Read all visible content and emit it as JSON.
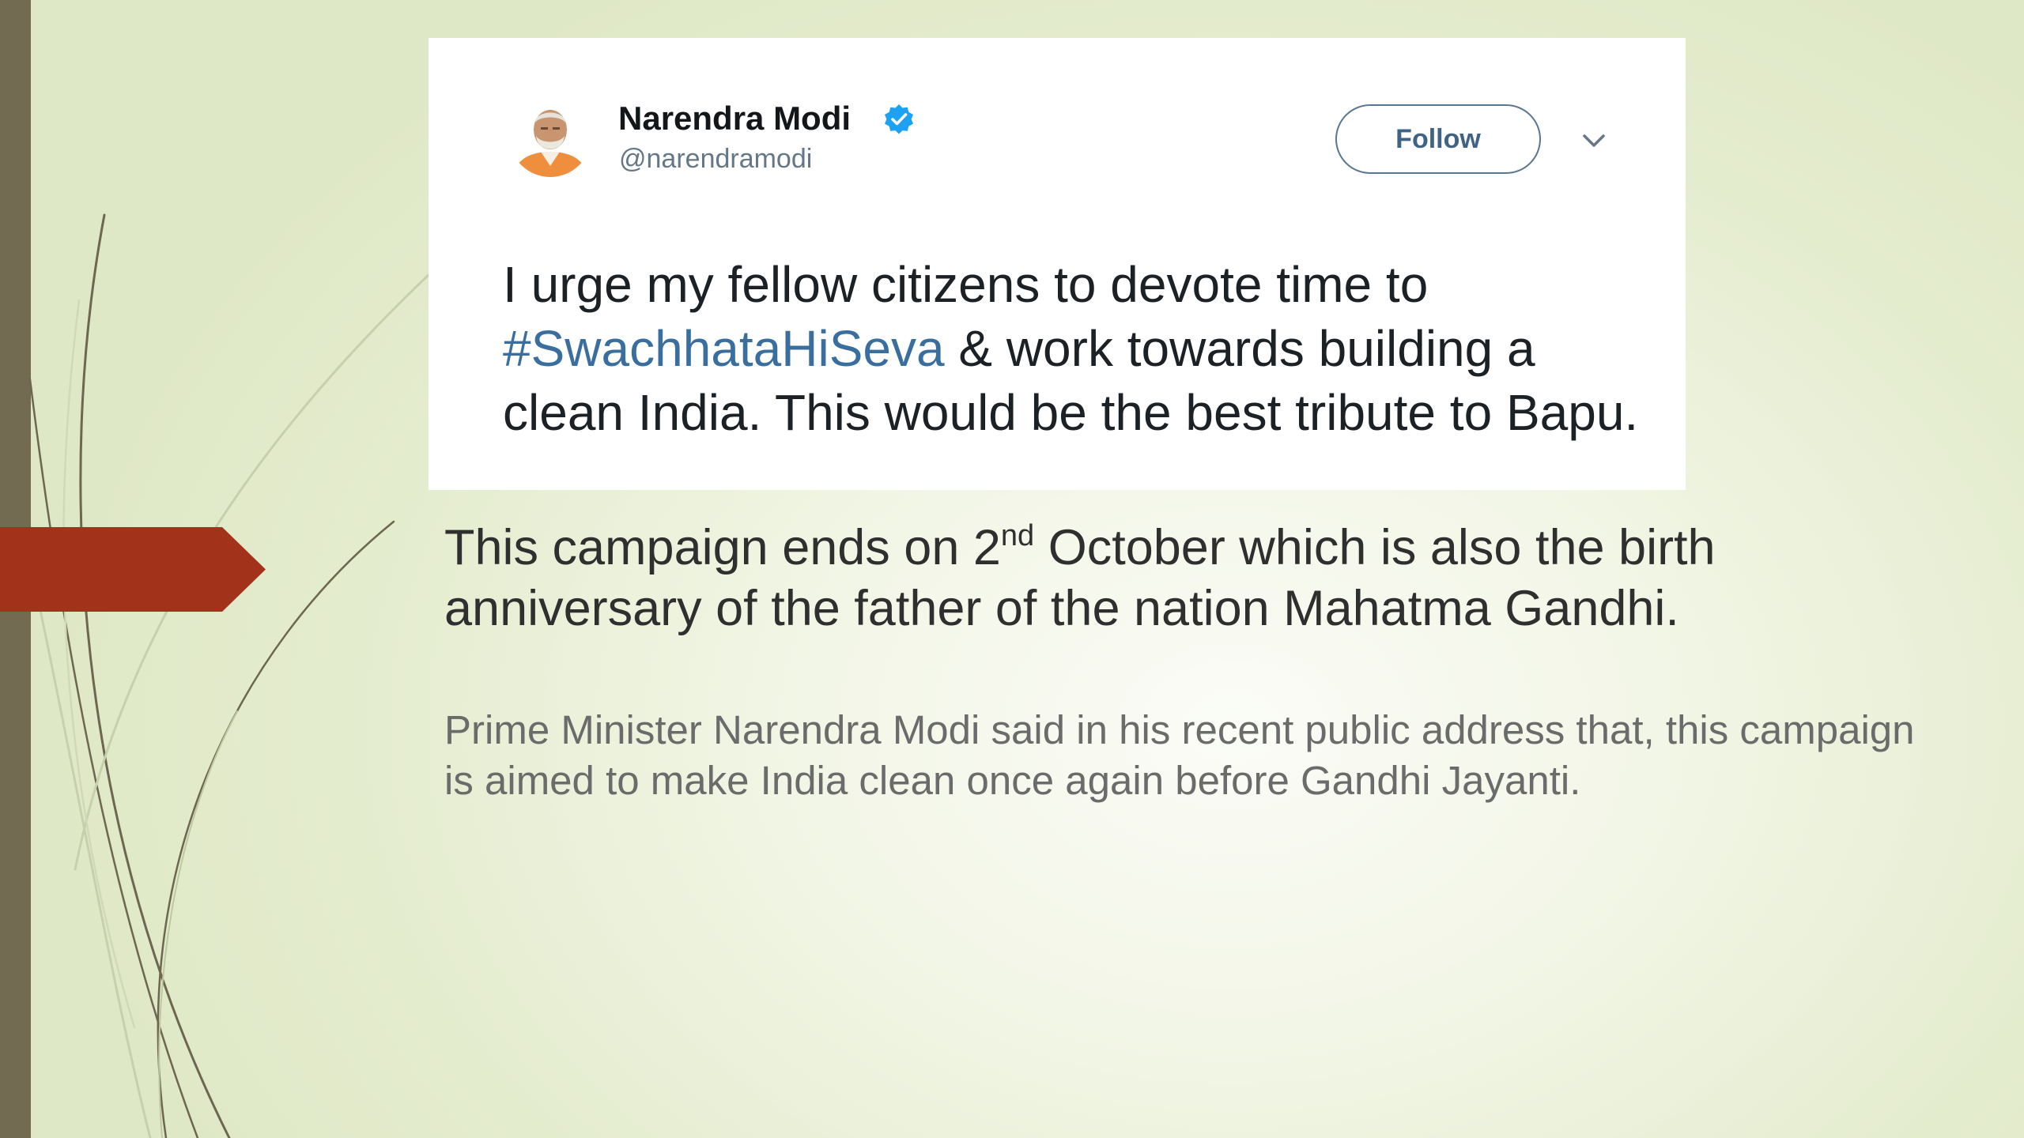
{
  "colors": {
    "left_bar": "#736a52",
    "arrow": "#a3321a",
    "hashtag": "#3a6e9f",
    "verified": "#1da1f2",
    "follow_border": "#5a7590"
  },
  "tweet": {
    "name": "Narendra Modi",
    "handle": "@narendramodi",
    "follow_label": "Follow",
    "text_before": "I urge my fellow citizens to devote time to ",
    "hashtag": "#SwachhataHiSeva",
    "text_after": " & work towards building a clean India. This would be the best tribute to Bapu."
  },
  "slide": {
    "para1_before": "This campaign ends on 2",
    "para1_sup": "nd",
    "para1_after": " October which is also the birth anniversary of the father of the nation Mahatma Gandhi.",
    "para2": "Prime Minister Narendra Modi said in his recent public address that, this campaign is aimed to make India clean once again before Gandhi Jayanti."
  },
  "icons": {
    "avatar": "avatar",
    "verified": "verified-badge-icon",
    "menu": "chevron-down-icon"
  }
}
